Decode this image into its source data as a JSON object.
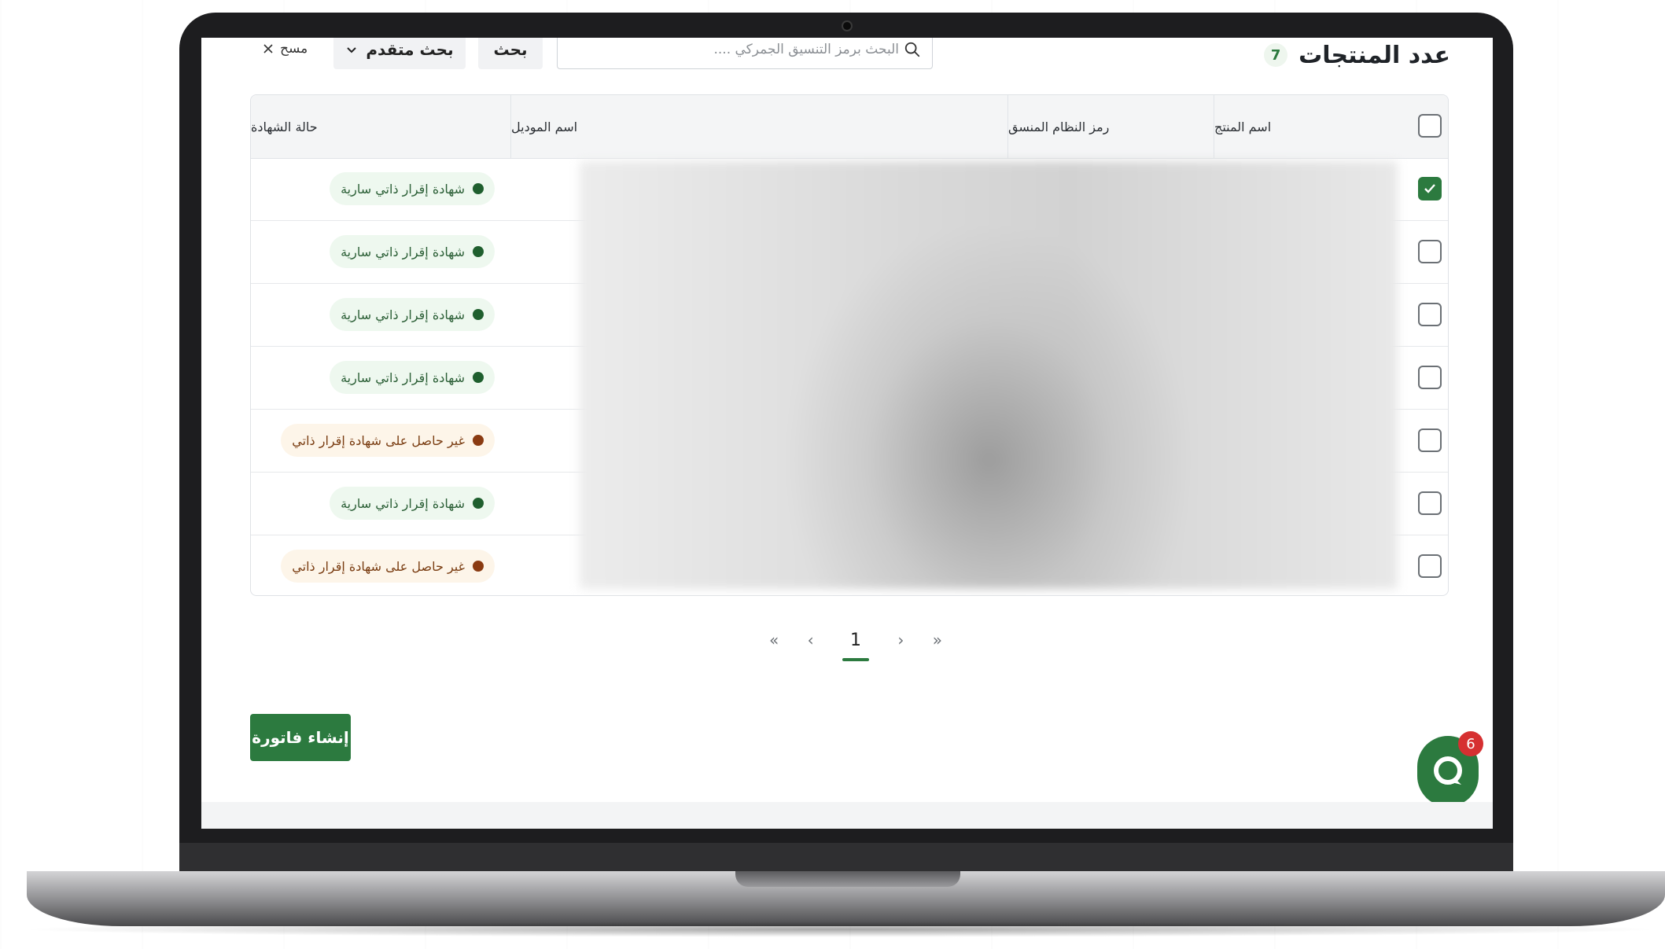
{
  "header": {
    "title": "عدد المنتجات",
    "count": "7"
  },
  "search": {
    "placeholder": "البحث برمز التنسيق الجمركي ....",
    "search_button": "بحث",
    "advanced_button": "بحث متقدم",
    "clear_button": "مسح"
  },
  "table": {
    "columns": [
      "اسم المنتج",
      "رمز النظام المنسق",
      "اسم الموديل",
      "حالة الشهادة"
    ],
    "rows": [
      {
        "checked": true,
        "status": "شهادة إقرار ذاتي سارية",
        "status_type": "ok"
      },
      {
        "checked": false,
        "status": "شهادة إقرار ذاتي سارية",
        "status_type": "ok"
      },
      {
        "checked": false,
        "status": "شهادة إقرار ذاتي سارية",
        "status_type": "ok"
      },
      {
        "checked": false,
        "status": "شهادة إقرار ذاتي سارية",
        "status_type": "ok"
      },
      {
        "checked": false,
        "status": "غير حاصل على شهادة إقرار ذاتي",
        "status_type": "warn"
      },
      {
        "checked": false,
        "status": "شهادة إقرار ذاتي سارية",
        "status_type": "ok"
      },
      {
        "checked": false,
        "status": "غير حاصل على شهادة إقرار ذاتي",
        "status_type": "warn"
      }
    ]
  },
  "pagination": {
    "first": "«",
    "prev": "‹",
    "current": "1",
    "next": "›",
    "last": "»"
  },
  "actions": {
    "create_invoice": "إنشاء فاتورة"
  },
  "chat": {
    "badge_count": "6"
  },
  "colors": {
    "primary": "#2c7a3f",
    "ok_bg": "#eef8ef",
    "warn_bg": "#fdf5e9",
    "badge": "#d63031"
  },
  "icons": {
    "search": "search-icon",
    "chevron": "chevron-down-icon",
    "clear": "close-icon",
    "check": "check-icon",
    "chat": "chat-icon"
  }
}
